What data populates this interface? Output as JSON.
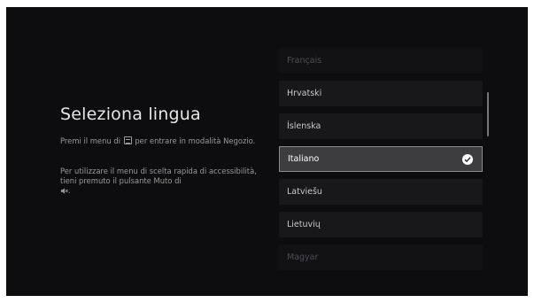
{
  "page": {
    "title": "Seleziona lingua",
    "desc1_before": "Premi il menu di",
    "desc1_after": "per entrare in modalità Negozio.",
    "desc2": "Per utilizzare il menu di scelta rapida di accessibilità, tieni premuto il pulsante Muto di"
  },
  "languages": {
    "items": [
      "Français",
      "Hrvatski",
      "Íslenska",
      "Italiano",
      "Latviešu",
      "Lietuvių",
      "Magyar"
    ],
    "selected": "Italiano"
  },
  "icons": {
    "menu": "menu-button-icon",
    "mute": "mute-icon",
    "check": "check-icon"
  },
  "colors": {
    "background": "#0d0d0f",
    "selected_item": "#3d3d40"
  }
}
